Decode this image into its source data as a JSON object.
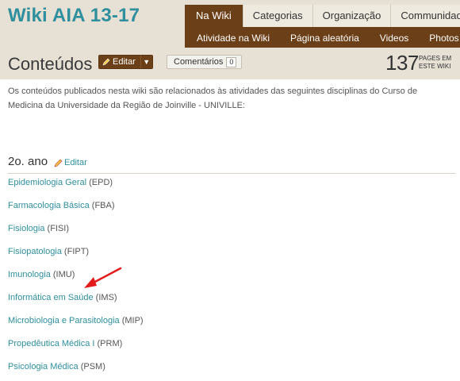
{
  "wiki": {
    "title": "Wiki AIA 13-17"
  },
  "nav": {
    "tabs": [
      {
        "label": "Na Wiki",
        "active": true
      },
      {
        "label": "Categorias",
        "active": false
      },
      {
        "label": "Organização",
        "active": false
      },
      {
        "label": "Communidade",
        "active": false
      }
    ],
    "subtabs": [
      {
        "label": "Atividade na Wiki"
      },
      {
        "label": "Página aleatória"
      },
      {
        "label": "Videos"
      },
      {
        "label": "Photos"
      }
    ]
  },
  "page": {
    "title": "Conteúdos",
    "edit_label": "Editar",
    "comments_label": "Comentários",
    "comments_count": "0",
    "pages_count": "137",
    "pages_label": "PAGES EM ESTE WIKI",
    "intro": "Os conteúdos publicados nesta wiki são relacionados às atividades das seguintes disciplinas do Curso de Medicina da Universidade da Região de Joinville - UNIVILLE:"
  },
  "section": {
    "title": "2o. ano",
    "edit_label": "Editar",
    "courses": [
      {
        "name": "Epidemiologia Geral",
        "code": " (EPD)"
      },
      {
        "name": "Farmacologia Básica",
        "code": " (FBA)"
      },
      {
        "name": "Fisiologia",
        "code": " (FISI)"
      },
      {
        "name": "Fisiopatologia",
        "code": " (FIPT)"
      },
      {
        "name": "Imunologia",
        "code": " (IMU)"
      },
      {
        "name": "Informática em Saúde",
        "code": " (IMS)"
      },
      {
        "name": "Microbiologia e Parasitologia",
        "code": " (MIP)"
      },
      {
        "name": "Propedêutica Médica I",
        "code": " (PRM)"
      },
      {
        "name": "Psicologia Médica",
        "code": " (PSM)"
      }
    ]
  },
  "colors": {
    "accent": "#2f8f9d",
    "brand_brown": "#6b3f17",
    "header_bg": "#e7e1d5",
    "annotation_arrow": "#e31b1b"
  },
  "icons": {
    "edit": "pencil-icon",
    "dropdown": "chevron-down-icon"
  }
}
